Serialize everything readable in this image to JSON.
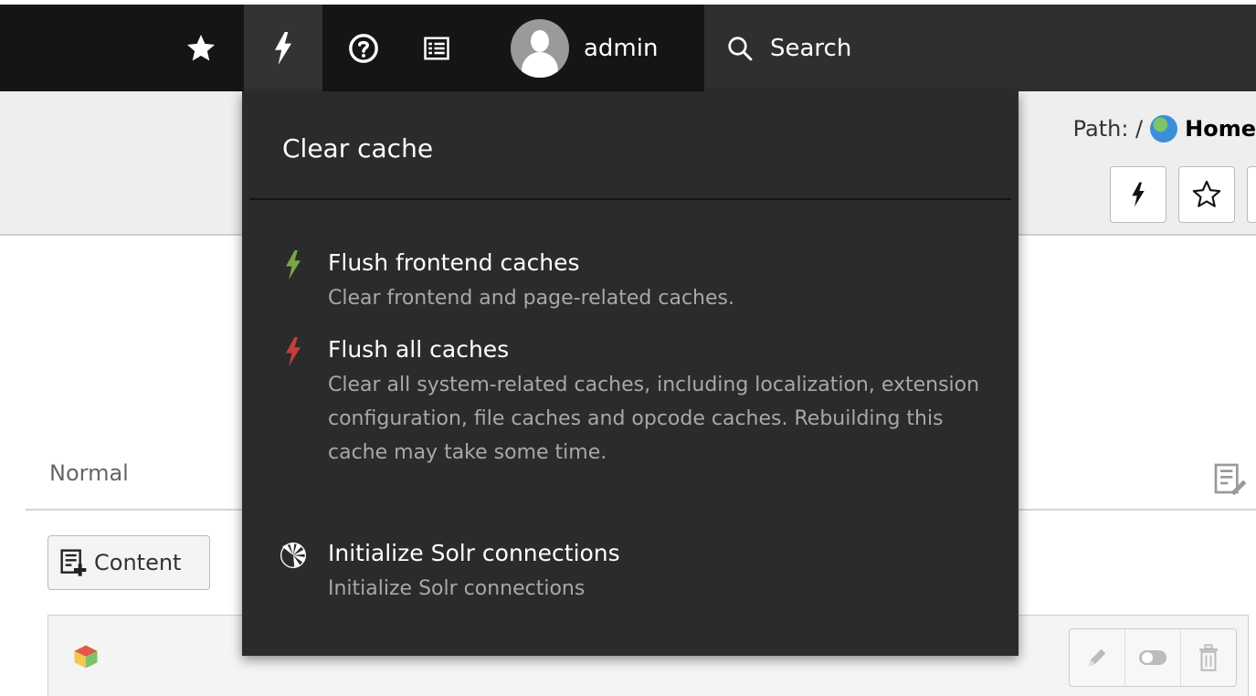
{
  "topbar": {
    "user": {
      "name": "admin"
    },
    "search": {
      "label": "Search"
    }
  },
  "docheader": {
    "path_label": "Path: /",
    "path_page": "Home"
  },
  "page_module": {
    "column_label": "Normal",
    "new_content_label": "Content"
  },
  "clear_cache_menu": {
    "title": "Clear cache",
    "items": [
      {
        "title": "Flush frontend caches",
        "description": "Clear frontend and page-related caches.",
        "icon": "bolt-icon",
        "icon_color": "#79a548"
      },
      {
        "title": "Flush all caches",
        "description": "Clear all system-related caches, including localization, extension configuration, file caches and opcode caches. Rebuilding this cache may take some time.",
        "icon": "bolt-icon",
        "icon_color": "#c83c3c"
      },
      {
        "title": "Initialize Solr connections",
        "description": "Initialize Solr connections",
        "icon": "solr-icon",
        "icon_color": "#ffffff"
      }
    ]
  }
}
